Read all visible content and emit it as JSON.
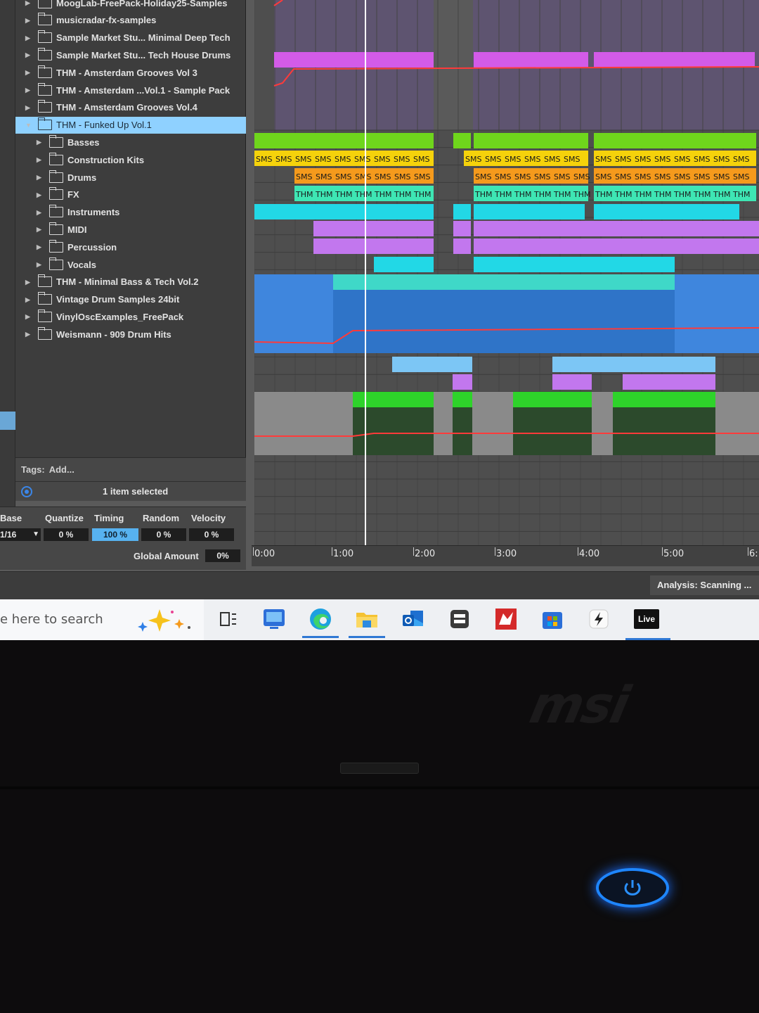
{
  "browser": {
    "items": [
      {
        "label": "MoogLab-FreePack-Holiday25-Samples",
        "indent": 0,
        "expanded": false,
        "selected": false
      },
      {
        "label": "musicradar-fx-samples",
        "indent": 0,
        "expanded": false,
        "selected": false
      },
      {
        "label": "Sample Market Stu... Minimal Deep Tech",
        "indent": 0,
        "expanded": false,
        "selected": false
      },
      {
        "label": "Sample Market Stu... Tech House Drums",
        "indent": 0,
        "expanded": false,
        "selected": false
      },
      {
        "label": "THM - Amsterdam Grooves Vol 3",
        "indent": 0,
        "expanded": false,
        "selected": false
      },
      {
        "label": "THM - Amsterdam ...Vol.1 - Sample Pack",
        "indent": 0,
        "expanded": false,
        "selected": false
      },
      {
        "label": "THM - Amsterdam Grooves Vol.4",
        "indent": 0,
        "expanded": false,
        "selected": false
      },
      {
        "label": "THM - Funked Up Vol.1",
        "indent": 0,
        "expanded": true,
        "selected": true
      },
      {
        "label": "Basses",
        "indent": 1,
        "expanded": false,
        "selected": false
      },
      {
        "label": "Construction Kits",
        "indent": 1,
        "expanded": false,
        "selected": false
      },
      {
        "label": "Drums",
        "indent": 1,
        "expanded": false,
        "selected": false
      },
      {
        "label": "FX",
        "indent": 1,
        "expanded": false,
        "selected": false
      },
      {
        "label": "Instruments",
        "indent": 1,
        "expanded": false,
        "selected": false
      },
      {
        "label": "MIDI",
        "indent": 1,
        "expanded": false,
        "selected": false
      },
      {
        "label": "Percussion",
        "indent": 1,
        "expanded": false,
        "selected": false
      },
      {
        "label": "Vocals",
        "indent": 1,
        "expanded": false,
        "selected": false
      },
      {
        "label": "THM - Minimal Bass & Tech Vol.2",
        "indent": 0,
        "expanded": false,
        "selected": false
      },
      {
        "label": "Vintage Drum Samples 24bit",
        "indent": 0,
        "expanded": false,
        "selected": false
      },
      {
        "label": "VinylOscExamples_FreePack",
        "indent": 0,
        "expanded": false,
        "selected": false
      },
      {
        "label": "Weismann - 909 Drum Hits",
        "indent": 0,
        "expanded": false,
        "selected": false
      }
    ],
    "tags_label": "Tags:",
    "tags_add": "Add...",
    "status": "1 item selected"
  },
  "groove": {
    "base_label": "Base",
    "base_value": "1/16",
    "quantize_label": "Quantize",
    "quantize_value": "0 %",
    "timing_label": "Timing",
    "timing_value": "100 %",
    "random_label": "Random",
    "random_value": "0 %",
    "velocity_label": "Velocity",
    "velocity_value": "0 %",
    "global_amount_label": "Global Amount",
    "global_amount_value": "0%"
  },
  "arrangement": {
    "ruler_ticks": [
      "0:00",
      "1:00",
      "2:00",
      "3:00",
      "4:00",
      "5:00",
      "6:"
    ],
    "clip_labels": {
      "yellow": "SMS",
      "orange": "SMS",
      "teal": "THM"
    },
    "colors": {
      "magenta": "#d35be8",
      "lime": "#6fd61c",
      "yellow": "#f5d20b",
      "orange": "#f59a1c",
      "teal": "#3ee6b4",
      "cyan": "#22d8e6",
      "lavender": "#c277ee",
      "blue_track": "#3f86dd",
      "light_blue": "#7cc6f5",
      "green": "#2ed32a",
      "automation": "#ff3a3a"
    }
  },
  "status_bar": {
    "analysis": "Analysis: Scanning ..."
  },
  "taskbar": {
    "search_placeholder": "e here to search",
    "icons": [
      "copilot-icon",
      "task-view-icon",
      "screen-app-icon",
      "edge-icon",
      "file-explorer-icon",
      "outlook-icon",
      "app-dark-icon",
      "red-app-icon",
      "store-icon",
      "dark-app-icon",
      "ableton-live-icon"
    ],
    "live_label": "Live"
  },
  "laptop": {
    "brand": "msi"
  }
}
